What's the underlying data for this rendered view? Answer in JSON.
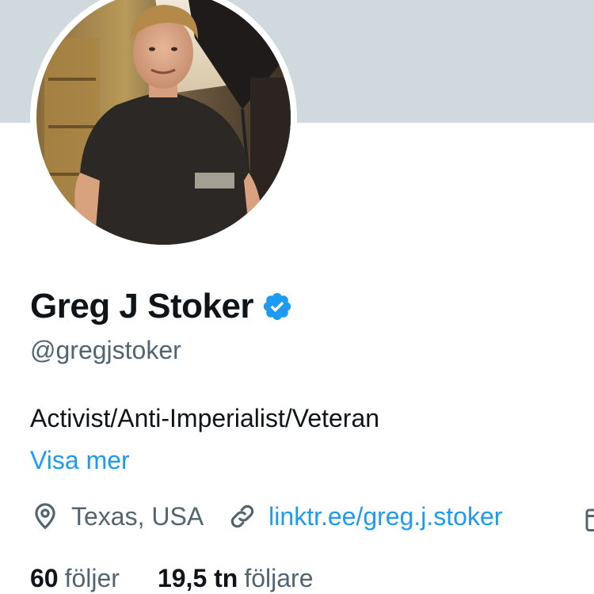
{
  "profile": {
    "display_name": "Greg J Stoker",
    "handle": "@gregjstoker",
    "bio": "Activist/Anti-Imperialist/Veteran",
    "show_more": "Visa mer",
    "location": "Texas, USA",
    "website": "linktr.ee/greg.j.stoker",
    "verified": true
  },
  "stats": {
    "following_count": "60",
    "following_label": "följer",
    "followers_count": "19,5 tn",
    "followers_label": "följare"
  },
  "icons": {
    "verified": "verified-badge-icon",
    "location": "location-pin-icon",
    "link": "link-icon",
    "calendar": "calendar-icon"
  },
  "colors": {
    "banner": "#cfd9de",
    "accent": "#1d9bf0",
    "text_primary": "#0f1419",
    "text_secondary": "#536471"
  }
}
